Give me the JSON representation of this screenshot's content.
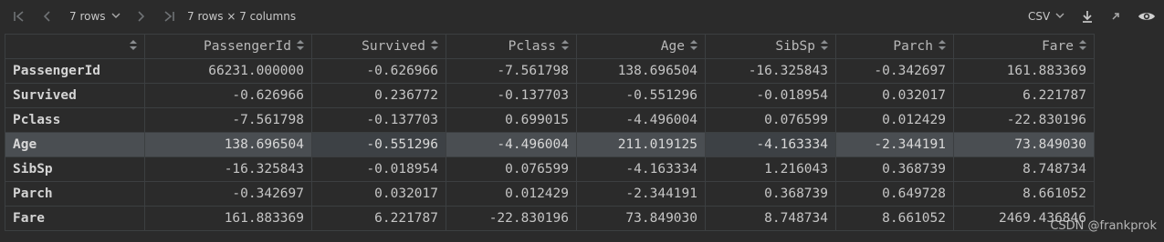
{
  "toolbar": {
    "rows_label": "7 rows",
    "summary": "7 rows × 7 columns",
    "format_label": "CSV"
  },
  "table": {
    "columns": [
      "PassengerId",
      "Survived",
      "Pclass",
      "Age",
      "SibSp",
      "Parch",
      "Fare"
    ],
    "rows": [
      {
        "label": "PassengerId",
        "values": [
          "66231.000000",
          "-0.626966",
          "-7.561798",
          "138.696504",
          "-16.325843",
          "-0.342697",
          "161.883369"
        ]
      },
      {
        "label": "Survived",
        "values": [
          "-0.626966",
          "0.236772",
          "-0.137703",
          "-0.551296",
          "-0.018954",
          "0.032017",
          "6.221787"
        ]
      },
      {
        "label": "Pclass",
        "values": [
          "-7.561798",
          "-0.137703",
          "0.699015",
          "-4.496004",
          "0.076599",
          "0.012429",
          "-22.830196"
        ]
      },
      {
        "label": "Age",
        "values": [
          "138.696504",
          "-0.551296",
          "-4.496004",
          "211.019125",
          "-4.163334",
          "-2.344191",
          "73.849030"
        ]
      },
      {
        "label": "SibSp",
        "values": [
          "-16.325843",
          "-0.018954",
          "0.076599",
          "-4.163334",
          "1.216043",
          "0.368739",
          "8.748734"
        ]
      },
      {
        "label": "Parch",
        "values": [
          "-0.342697",
          "0.032017",
          "0.012429",
          "-2.344191",
          "0.368739",
          "0.649728",
          "8.661052"
        ]
      },
      {
        "label": "Fare",
        "values": [
          "161.883369",
          "6.221787",
          "-22.830196",
          "73.849030",
          "8.748734",
          "8.661052",
          "2469.436846"
        ]
      }
    ],
    "selected_row": "Age"
  },
  "watermark": "CSDN @frankprok",
  "icons": [
    "first-page-icon",
    "prev-page-icon",
    "next-page-icon",
    "last-page-icon",
    "chevron-down-icon",
    "download-icon",
    "expand-icon",
    "eye-icon",
    "sort-icon"
  ],
  "colors": {
    "background": "#2b2b2b",
    "selected_row": "#4a4e52",
    "grid_line": "#3c3f41"
  }
}
